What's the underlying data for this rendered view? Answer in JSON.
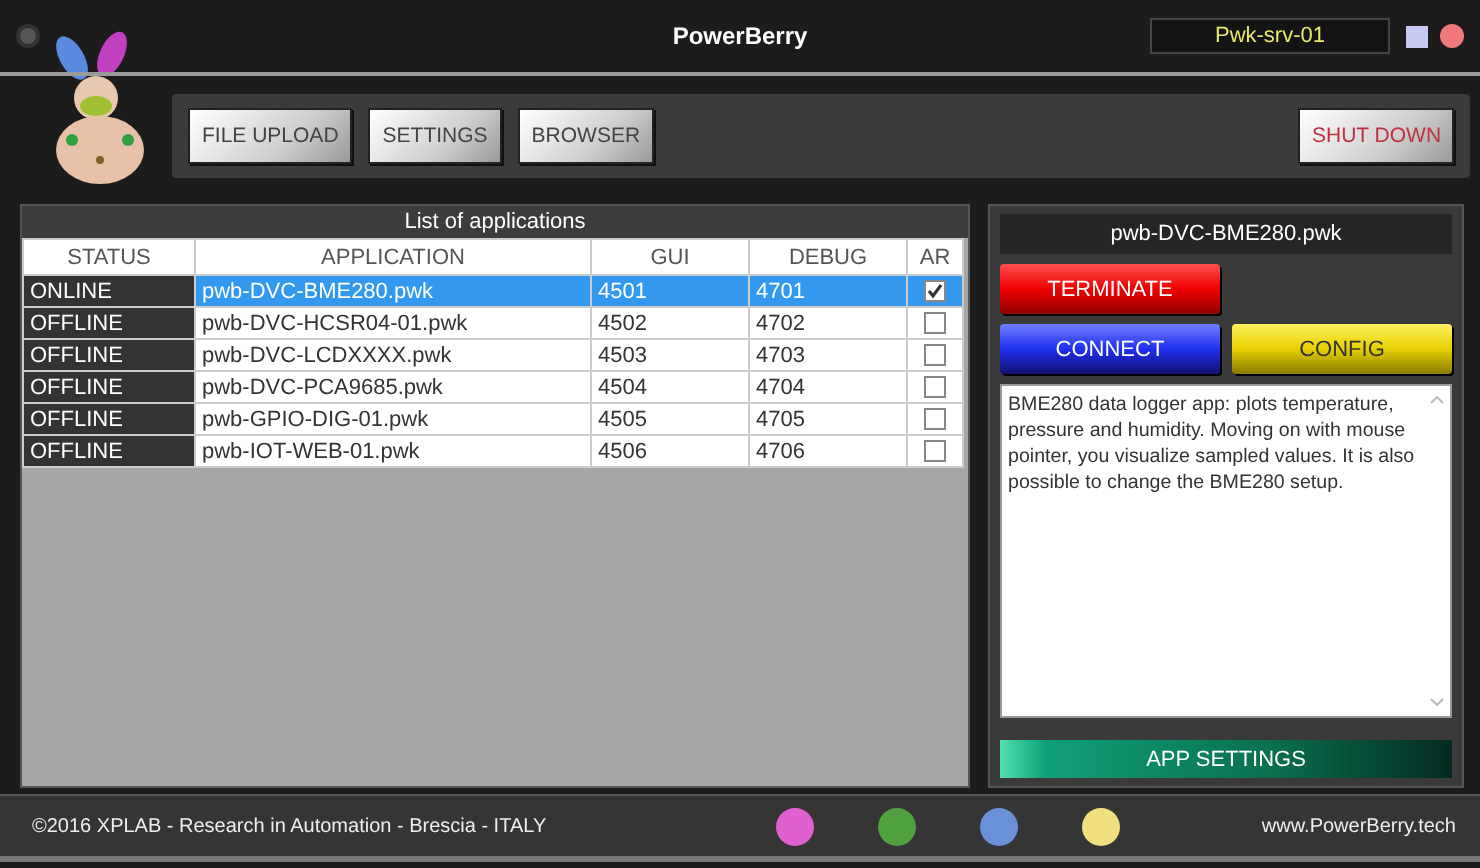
{
  "window": {
    "title": "PowerBerry",
    "server": "Pwk-srv-01"
  },
  "toolbar": {
    "buttons": [
      {
        "label": "FILE UPLOAD",
        "kind": "plain"
      },
      {
        "label": "SETTINGS",
        "kind": "plain"
      },
      {
        "label": "BROWSER",
        "kind": "plain"
      }
    ],
    "shutdown": {
      "label": "SHUT DOWN"
    }
  },
  "applications": {
    "title": "List of applications",
    "columns": [
      "STATUS",
      "APPLICATION",
      "GUI",
      "DEBUG",
      "AR"
    ],
    "rows": [
      {
        "status": "ONLINE",
        "application": "pwb-DVC-BME280.pwk",
        "gui": "4501",
        "debug": "4701",
        "checked": true,
        "selected": true
      },
      {
        "status": "OFFLINE",
        "application": "pwb-DVC-HCSR04-01.pwk",
        "gui": "4502",
        "debug": "4702",
        "checked": false,
        "selected": false
      },
      {
        "status": "OFFLINE",
        "application": "pwb-DVC-LCDXXXX.pwk",
        "gui": "4503",
        "debug": "4703",
        "checked": false,
        "selected": false
      },
      {
        "status": "OFFLINE",
        "application": "pwb-DVC-PCA9685.pwk",
        "gui": "4504",
        "debug": "4704",
        "checked": false,
        "selected": false
      },
      {
        "status": "OFFLINE",
        "application": "pwb-GPIO-DIG-01.pwk",
        "gui": "4505",
        "debug": "4705",
        "checked": false,
        "selected": false
      },
      {
        "status": "OFFLINE",
        "application": "pwb-IOT-WEB-01.pwk",
        "gui": "4506",
        "debug": "4706",
        "checked": false,
        "selected": false
      }
    ]
  },
  "details": {
    "filename": "pwb-DVC-BME280.pwk",
    "buttons": [
      {
        "label": "TERMINATE",
        "kind": "red"
      },
      {
        "label": "CONNECT",
        "kind": "blue"
      },
      {
        "label": "CONFIG",
        "kind": "yellow"
      }
    ],
    "description": "BME280 data logger app: plots temperature, pressure and humidity. Moving on with mouse pointer, you visualize sampled values. It is also possible to change the BME280 setup.",
    "app_settings": {
      "label": "APP SETTINGS",
      "kind": "green"
    }
  },
  "footer": {
    "copyright": "©2016 XPLAB - Research in Automation - Brescia - ITALY",
    "dots": [
      {
        "color": "#e060d0"
      },
      {
        "color": "#50a040"
      },
      {
        "color": "#6a90d8"
      },
      {
        "color": "#f0e080"
      }
    ],
    "website": "www.PowerBerry.tech"
  }
}
